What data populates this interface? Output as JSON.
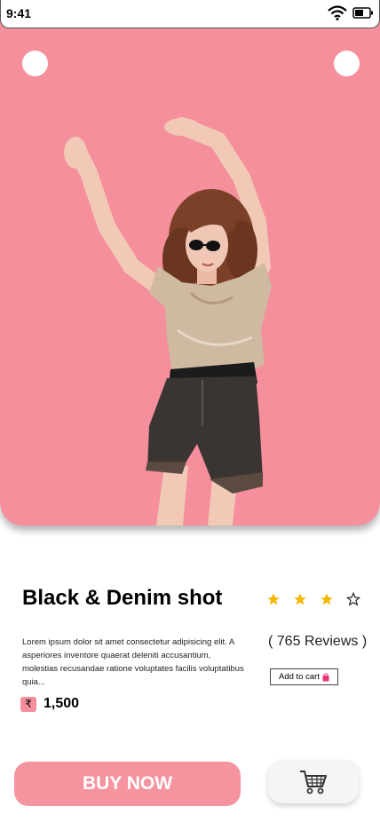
{
  "status_bar": {
    "time": "9:41",
    "icons": [
      "wifi-icon",
      "battery-icon"
    ]
  },
  "hero": {
    "background": "#f48f9b",
    "image": "woman-dancing-in-denim-shorts"
  },
  "product": {
    "title": "Black & Denim shot",
    "rating": {
      "filled": 3,
      "total": 4,
      "star_color": "#f5b800"
    },
    "reviews": "( 765 Reviews )",
    "description": "Lorem ipsum dolor sit amet consectetur adipisicing elit. A asperiores inventore quaerat deleniti accusantium, molestias recusandae ratione voluptates facilis voluptatibus quia...",
    "add_to_cart": "Add to cart",
    "currency_symbol": "₹",
    "price": "1,500"
  },
  "actions": {
    "buy_now": "BUY NOW",
    "buy_color": "#f4949f",
    "cart_icon": "shopping-cart-icon"
  }
}
